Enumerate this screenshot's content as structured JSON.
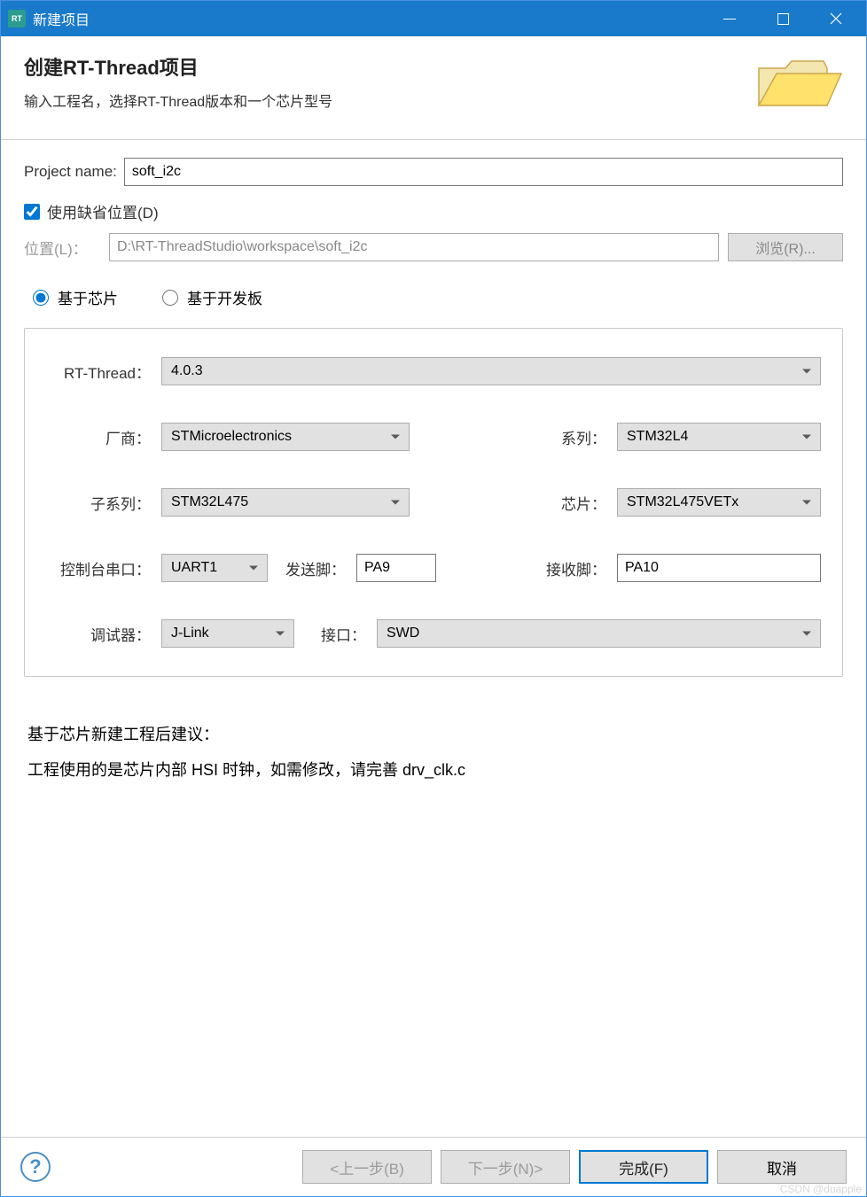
{
  "window": {
    "title": "新建项目"
  },
  "header": {
    "title": "创建RT-Thread项目",
    "subtitle": "输入工程名，选择RT-Thread版本和一个芯片型号"
  },
  "fields": {
    "project_name_label": "Project name:",
    "project_name_value": "soft_i2c",
    "use_default_location_label": "使用缺省位置(D)",
    "location_label": "位置(L)：",
    "location_value": "D:\\RT-ThreadStudio\\workspace\\soft_i2c",
    "browse_button": "浏览(R)..."
  },
  "radios": {
    "by_chip": "基于芯片",
    "by_board": "基于开发板"
  },
  "config": {
    "rtthread_label": "RT-Thread：",
    "rtthread_value": "4.0.3",
    "vendor_label": "厂商：",
    "vendor_value": "STMicroelectronics",
    "series_label": "系列：",
    "series_value": "STM32L4",
    "subseries_label": "子系列：",
    "subseries_value": "STM32L475",
    "chip_label": "芯片：",
    "chip_value": "STM32L475VETx",
    "console_label": "控制台串口：",
    "console_value": "UART1",
    "tx_label": "发送脚：",
    "tx_value": "PA9",
    "rx_label": "接收脚：",
    "rx_value": "PA10",
    "debugger_label": "调试器：",
    "debugger_value": "J-Link",
    "interface_label": "接口：",
    "interface_value": "SWD"
  },
  "notes": {
    "heading": "基于芯片新建工程后建议：",
    "line1": "工程使用的是芯片内部 HSI 时钟，如需修改，请完善 drv_clk.c"
  },
  "footer": {
    "back": "<上一步(B)",
    "next": "下一步(N)>",
    "finish": "完成(F)",
    "cancel": "取消"
  },
  "watermark": "CSDN @duapple"
}
